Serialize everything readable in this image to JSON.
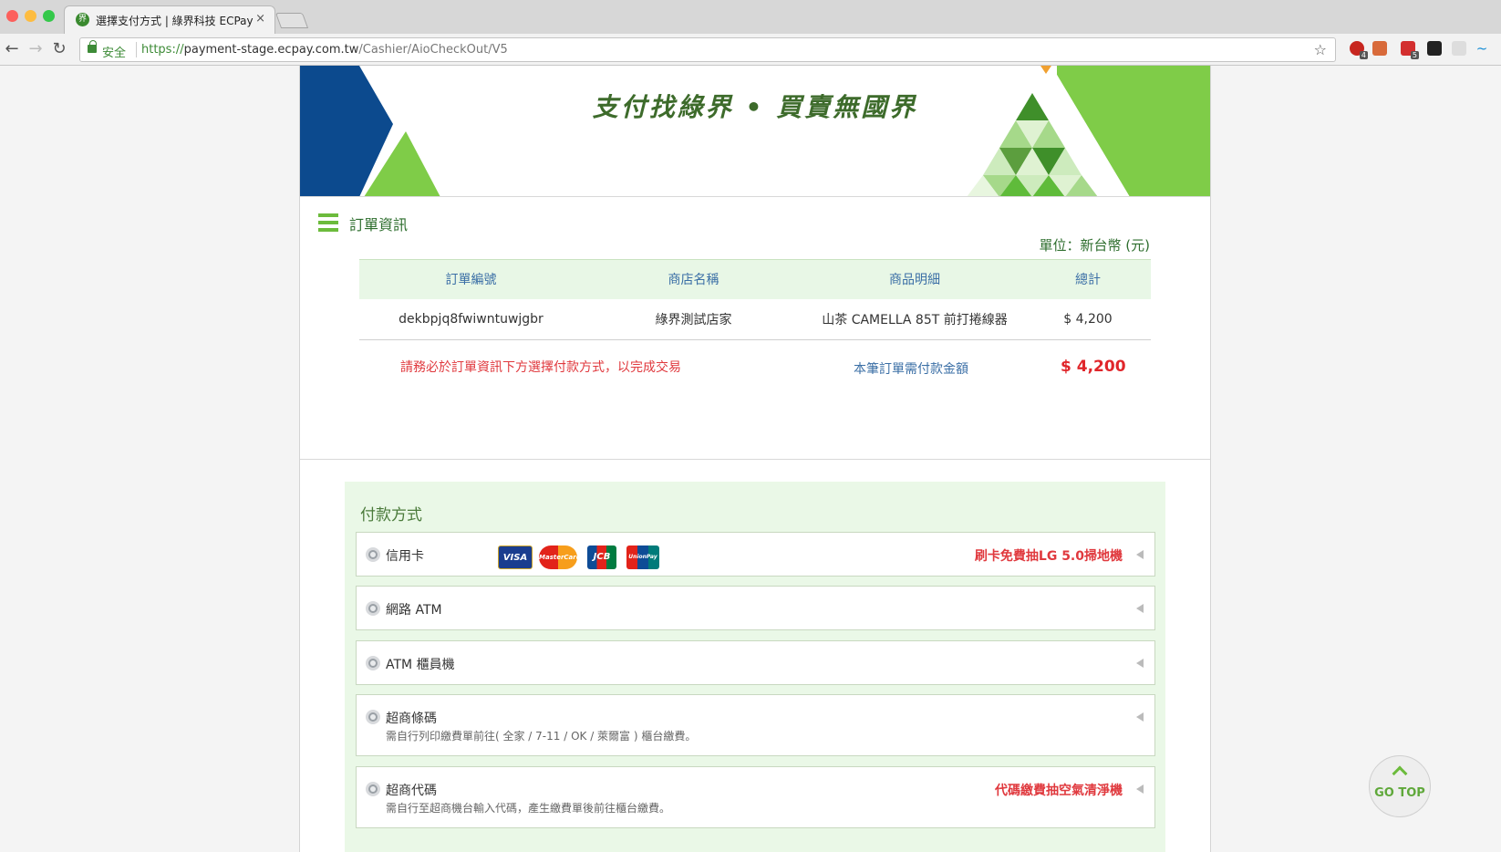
{
  "browser": {
    "tab_title": "選擇支付方式 | 綠界科技 ECPay",
    "tab_favicon_text": "界",
    "close_glyph": "×",
    "secure_label": "安全",
    "url_scheme": "https://",
    "url_host": "payment-stage.ecpay.com.tw",
    "url_path": "/Cashier/AioCheckOut/V5",
    "back_icon": "←",
    "forward_icon": "→",
    "reload_icon": "↻",
    "bookmark_icon": "☆",
    "extensions": [
      "abp-icon",
      "bookmark-ext-icon",
      "shield-ext-icon",
      "horse-ext-icon",
      "grid-ext-icon",
      "wave-ext-icon"
    ],
    "extension_badges": [
      "4",
      "",
      "5",
      "",
      "",
      ""
    ]
  },
  "header": {
    "slogan": "支付找綠界 • 買賣無國界"
  },
  "order": {
    "section_title": "訂單資訊",
    "unit_note": "單位：新台幣 (元)",
    "columns": [
      "訂單編號",
      "商店名稱",
      "商品明細",
      "總計"
    ],
    "rows": [
      [
        "dekbpjq8fwiwntuwjgbr",
        "綠界測試店家",
        "山茶 CAMELLA 85T 前打捲線器",
        "$ 4,200"
      ]
    ],
    "notice": "請務必於訂單資訊下方選擇付款方式，以完成交易",
    "total_label": "本筆訂單需付款金額",
    "total_amount": "$ 4,200"
  },
  "payment": {
    "title": "付款方式",
    "options": [
      {
        "label": "信用卡",
        "desc": "",
        "promo": "刷卡免費抽LG 5.0掃地機",
        "logos": [
          "VISA",
          "MasterCard",
          "JCB",
          "UnionPay"
        ]
      },
      {
        "label": "網路 ATM",
        "desc": "",
        "promo": ""
      },
      {
        "label": "ATM 櫃員機",
        "desc": "",
        "promo": ""
      },
      {
        "label": "超商條碼",
        "desc": "需自行列印繳費單前往( 全家 / 7-11 / OK / 萊爾富 ) 櫃台繳費。",
        "promo": ""
      },
      {
        "label": "超商代碼",
        "desc": "需自行至超商機台輸入代碼，產生繳費單後前往櫃台繳費。",
        "promo": "代碼繳費抽空氣清淨機"
      }
    ]
  },
  "gotop": {
    "label": "GO TOP"
  },
  "colors": {
    "brand_green": "#6cbb3c",
    "dark_blue": "#0c4a8e",
    "alert_red": "#e0393e",
    "link_blue": "#3b6fa6"
  }
}
